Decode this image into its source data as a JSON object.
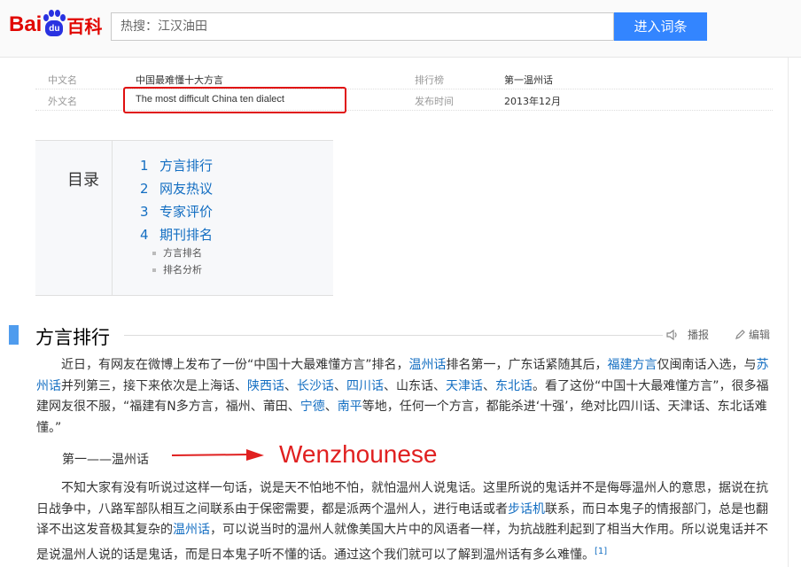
{
  "header": {
    "logo_bai": "Bai",
    "logo_du": "du",
    "logo_baike": "百科",
    "search_value": "热搜：江汉油田",
    "enter_button": "进入词条"
  },
  "infobox": {
    "rows": [
      {
        "label1": "中文名",
        "value1": "中国最难懂十大方言",
        "label2": "排行榜",
        "value2": "第一温州话"
      },
      {
        "label1": "外文名",
        "value1": "The most difficult China ten dialect",
        "label2": "发布时间",
        "value2": "2013年12月"
      }
    ]
  },
  "toc": {
    "title": "目录",
    "items": [
      {
        "num": "1",
        "label": "方言排行"
      },
      {
        "num": "2",
        "label": "网友热议"
      },
      {
        "num": "3",
        "label": "专家评价"
      },
      {
        "num": "4",
        "label": "期刊排名"
      }
    ],
    "subitems": [
      "方言排名",
      "排名分析"
    ]
  },
  "section": {
    "title": "方言排行",
    "broadcast": "播报",
    "edit": "编辑"
  },
  "para1": {
    "t1": "近日，有网友在微博上发布了一份“中国十大最难懂方言”排名，",
    "l1": "温州话",
    "t2": "排名第一，广东话紧随其后，",
    "l2": "福建方言",
    "t3": "仅闽南话入选，与",
    "l3": "苏州话",
    "t4": "并列第三，接下来依次是上海话、",
    "l4": "陕西话",
    "t5": "、",
    "l5": "长沙话",
    "t6": "、",
    "l6": "四川话",
    "t7": "、山东话、",
    "l7": "天津话",
    "t8": "、",
    "l8": "东北话",
    "t9": "。看了这份“中国十大最难懂方言”，很多福建网友很不服，“福建有N多方言，福州、莆田、",
    "l9": "宁德",
    "t10": "、",
    "l10": "南平",
    "t11": "等地，任何一个方言，都能杀进‘十强’，绝对比四川话、天津话、东北话难懂。”"
  },
  "first_line": "第一——温州话",
  "annotation": "Wenzhounese",
  "para2": {
    "t1": "不知大家有没有听说过这样一句话，说是天不怕地不怕，就怕温州人说鬼话。这里所说的鬼话并不是侮辱温州人的意思，据说在抗日战争中，八路军部队相互之间联系由于保密需要，都是派两个温州人，进行电话或者",
    "l1": "步话机",
    "t2": "联系，而日本鬼子的情报部门，总是也翻译不出这发音极其复杂的",
    "l2": "温州话",
    "t3": "，可以说当时的温州人就像美国大片中的风语者一样，为抗战胜利起到了相当大作用。所以说鬼话并不是说温州人说的话是鬼话，而是日本鬼子听不懂的话。通过这个我们就可以了解到温州话有多么难懂。",
    "ref": "[1]"
  }
}
